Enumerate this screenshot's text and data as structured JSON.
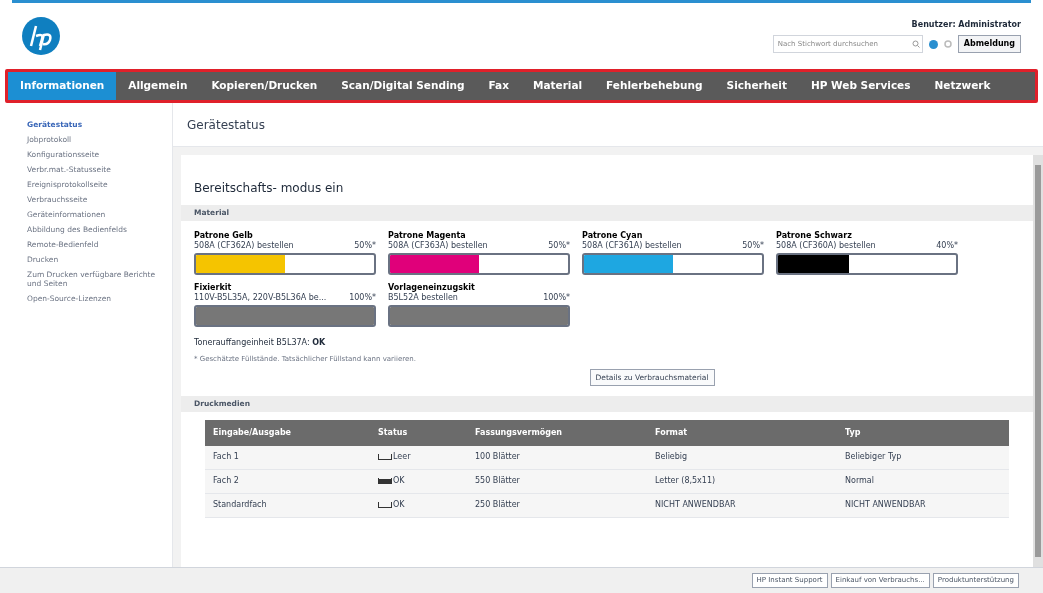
{
  "header": {
    "search": {
      "placeholder": "Nach Stichwort durchsuchen"
    },
    "user": "Benutzer: Administrator",
    "logout": "Abmeldung"
  },
  "tabs": [
    {
      "label": "Informationen",
      "selected": true
    },
    {
      "label": "Allgemein",
      "selected": false
    },
    {
      "label": "Kopieren/Drucken",
      "selected": false
    },
    {
      "label": "Scan/Digital Sending",
      "selected": false
    },
    {
      "label": "Fax",
      "selected": false
    },
    {
      "label": "Material",
      "selected": false
    },
    {
      "label": "Fehlerbehebung",
      "selected": false
    },
    {
      "label": "Sicherheit",
      "selected": false
    },
    {
      "label": "HP Web Services",
      "selected": false
    },
    {
      "label": "Netzwerk",
      "selected": false
    }
  ],
  "sidebar": {
    "items": [
      {
        "label": "Gerätestatus",
        "selected": true
      },
      {
        "label": "Jobprotokoll",
        "selected": false
      },
      {
        "label": "Konfigurationsseite",
        "selected": false
      },
      {
        "label": "Verbr.mat.-Statusseite",
        "selected": false
      },
      {
        "label": "Ereignisprotokollseite",
        "selected": false
      },
      {
        "label": "Verbrauchsseite",
        "selected": false
      },
      {
        "label": "Geräteinformationen",
        "selected": false
      },
      {
        "label": "Abbildung des Bedienfelds",
        "selected": false
      },
      {
        "label": "Remote-Bedienfeld",
        "selected": false
      },
      {
        "label": "Drucken",
        "selected": false
      },
      {
        "label": "Zum Drucken verfügbare Berichte und Seiten",
        "selected": false
      },
      {
        "label": "Open-Source-Lizenzen",
        "selected": false
      }
    ]
  },
  "page_title": "Gerätestatus",
  "status": "Bereitschafts- modus ein",
  "supplies": {
    "heading": "Material",
    "items": [
      {
        "name": "Patrone Gelb",
        "order": "508A (CF362A) bestellen",
        "reading": "50%*",
        "level": 0.5,
        "color": "#f5c400"
      },
      {
        "name": "Patrone Magenta",
        "order": "508A (CF363A) bestellen",
        "reading": "50%*",
        "level": 0.5,
        "color": "#e0007a"
      },
      {
        "name": "Patrone Cyan",
        "order": "508A (CF361A) bestellen",
        "reading": "50%*",
        "level": 0.5,
        "color": "#1ea7e1"
      },
      {
        "name": "Patrone Schwarz",
        "order": "508A (CF360A) bestellen",
        "reading": "40%*",
        "level": 0.4,
        "color": "#000000"
      },
      {
        "name": "Fixierkit",
        "order": "110V-B5L35A, 220V-B5L36A be...",
        "reading": "100%*",
        "level": 1,
        "color": "#777777"
      },
      {
        "name": "Vorlageneinzugskit",
        "order": "B5L52A bestellen",
        "reading": "100%*",
        "level": 1,
        "color": "#777777"
      }
    ],
    "toner_collection": "Tonerauffangeinheit B5L37A: **OK**",
    "note": "* Geschätzte Füllstände. Tatsächlicher Füllstand kann variieren.",
    "details_button": "Details zu Verbrauchsmaterial"
  },
  "media": {
    "heading": "Druckmedien",
    "columns": [
      "Eingabe/Ausgabe",
      "Status",
      "Fassungsvermögen",
      "Format",
      "Typ"
    ],
    "rows": [
      {
        "tray": "Fach 1",
        "tray_full": false,
        "status": "Leer",
        "capacity": "100 Blätter",
        "format": "Beliebig",
        "type": "Beliebiger Typ"
      },
      {
        "tray": "Fach 2",
        "tray_full": true,
        "status": "OK",
        "capacity": "550 Blätter",
        "format": "Letter (8,5x11)",
        "type": "Normal"
      },
      {
        "tray": "Standardfach",
        "tray_full": false,
        "status": "OK",
        "capacity": "250 Blätter",
        "format": "NICHT ANWENDBAR",
        "type": "NICHT ANWENDBAR"
      }
    ]
  },
  "footer": {
    "links": [
      "HP Instant Support",
      "Einkauf von Verbrauchs...",
      "Produktunterstützung"
    ]
  }
}
